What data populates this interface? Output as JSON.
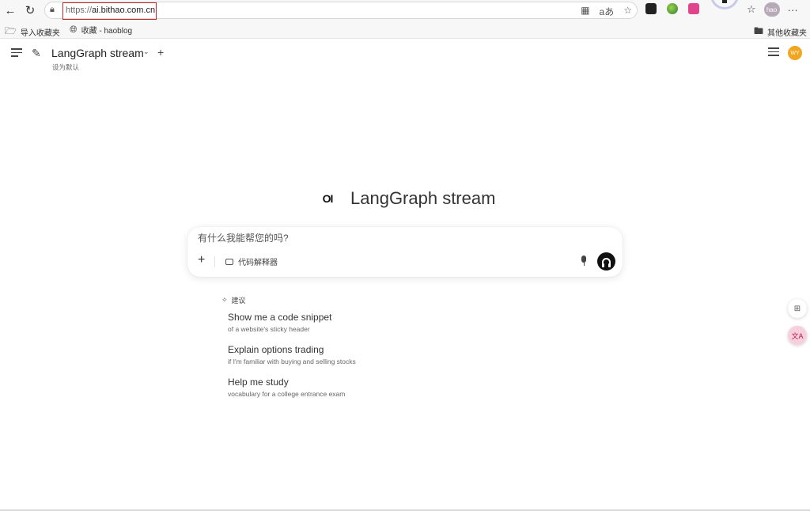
{
  "browser": {
    "url_protocol": "https://",
    "url_host": "ai.bithao.com.cn",
    "translate_glyph": "aあ",
    "profile_label": "hao",
    "more_glyph": "···",
    "bookmarks": [
      {
        "label": "导入收藏夹"
      },
      {
        "label": "收藏 - haoblog"
      }
    ],
    "other_bookmarks": "其他收藏夹"
  },
  "header": {
    "model_name": "LangGraph stream",
    "set_default": "设为默认",
    "avatar_initials": "WY",
    "avatar_color": "#f2a51f"
  },
  "hero": {
    "logo_text": "OI",
    "title": "LangGraph stream"
  },
  "chat": {
    "placeholder": "有什么我能帮您的吗?",
    "code_interpreter": "代码解释器"
  },
  "suggestions": {
    "heading": "建议",
    "items": [
      {
        "title": "Show me a code snippet",
        "subtitle": "of a website's sticky header"
      },
      {
        "title": "Explain options trading",
        "subtitle": "if I'm familiar with buying and selling stocks"
      },
      {
        "title": "Help me study",
        "subtitle": "vocabulary for a college entrance exam"
      }
    ]
  },
  "floating": {
    "translate_glyph": "文A"
  },
  "colors": {
    "accent_dark": "#111111",
    "url_highlight": "#c62828"
  }
}
